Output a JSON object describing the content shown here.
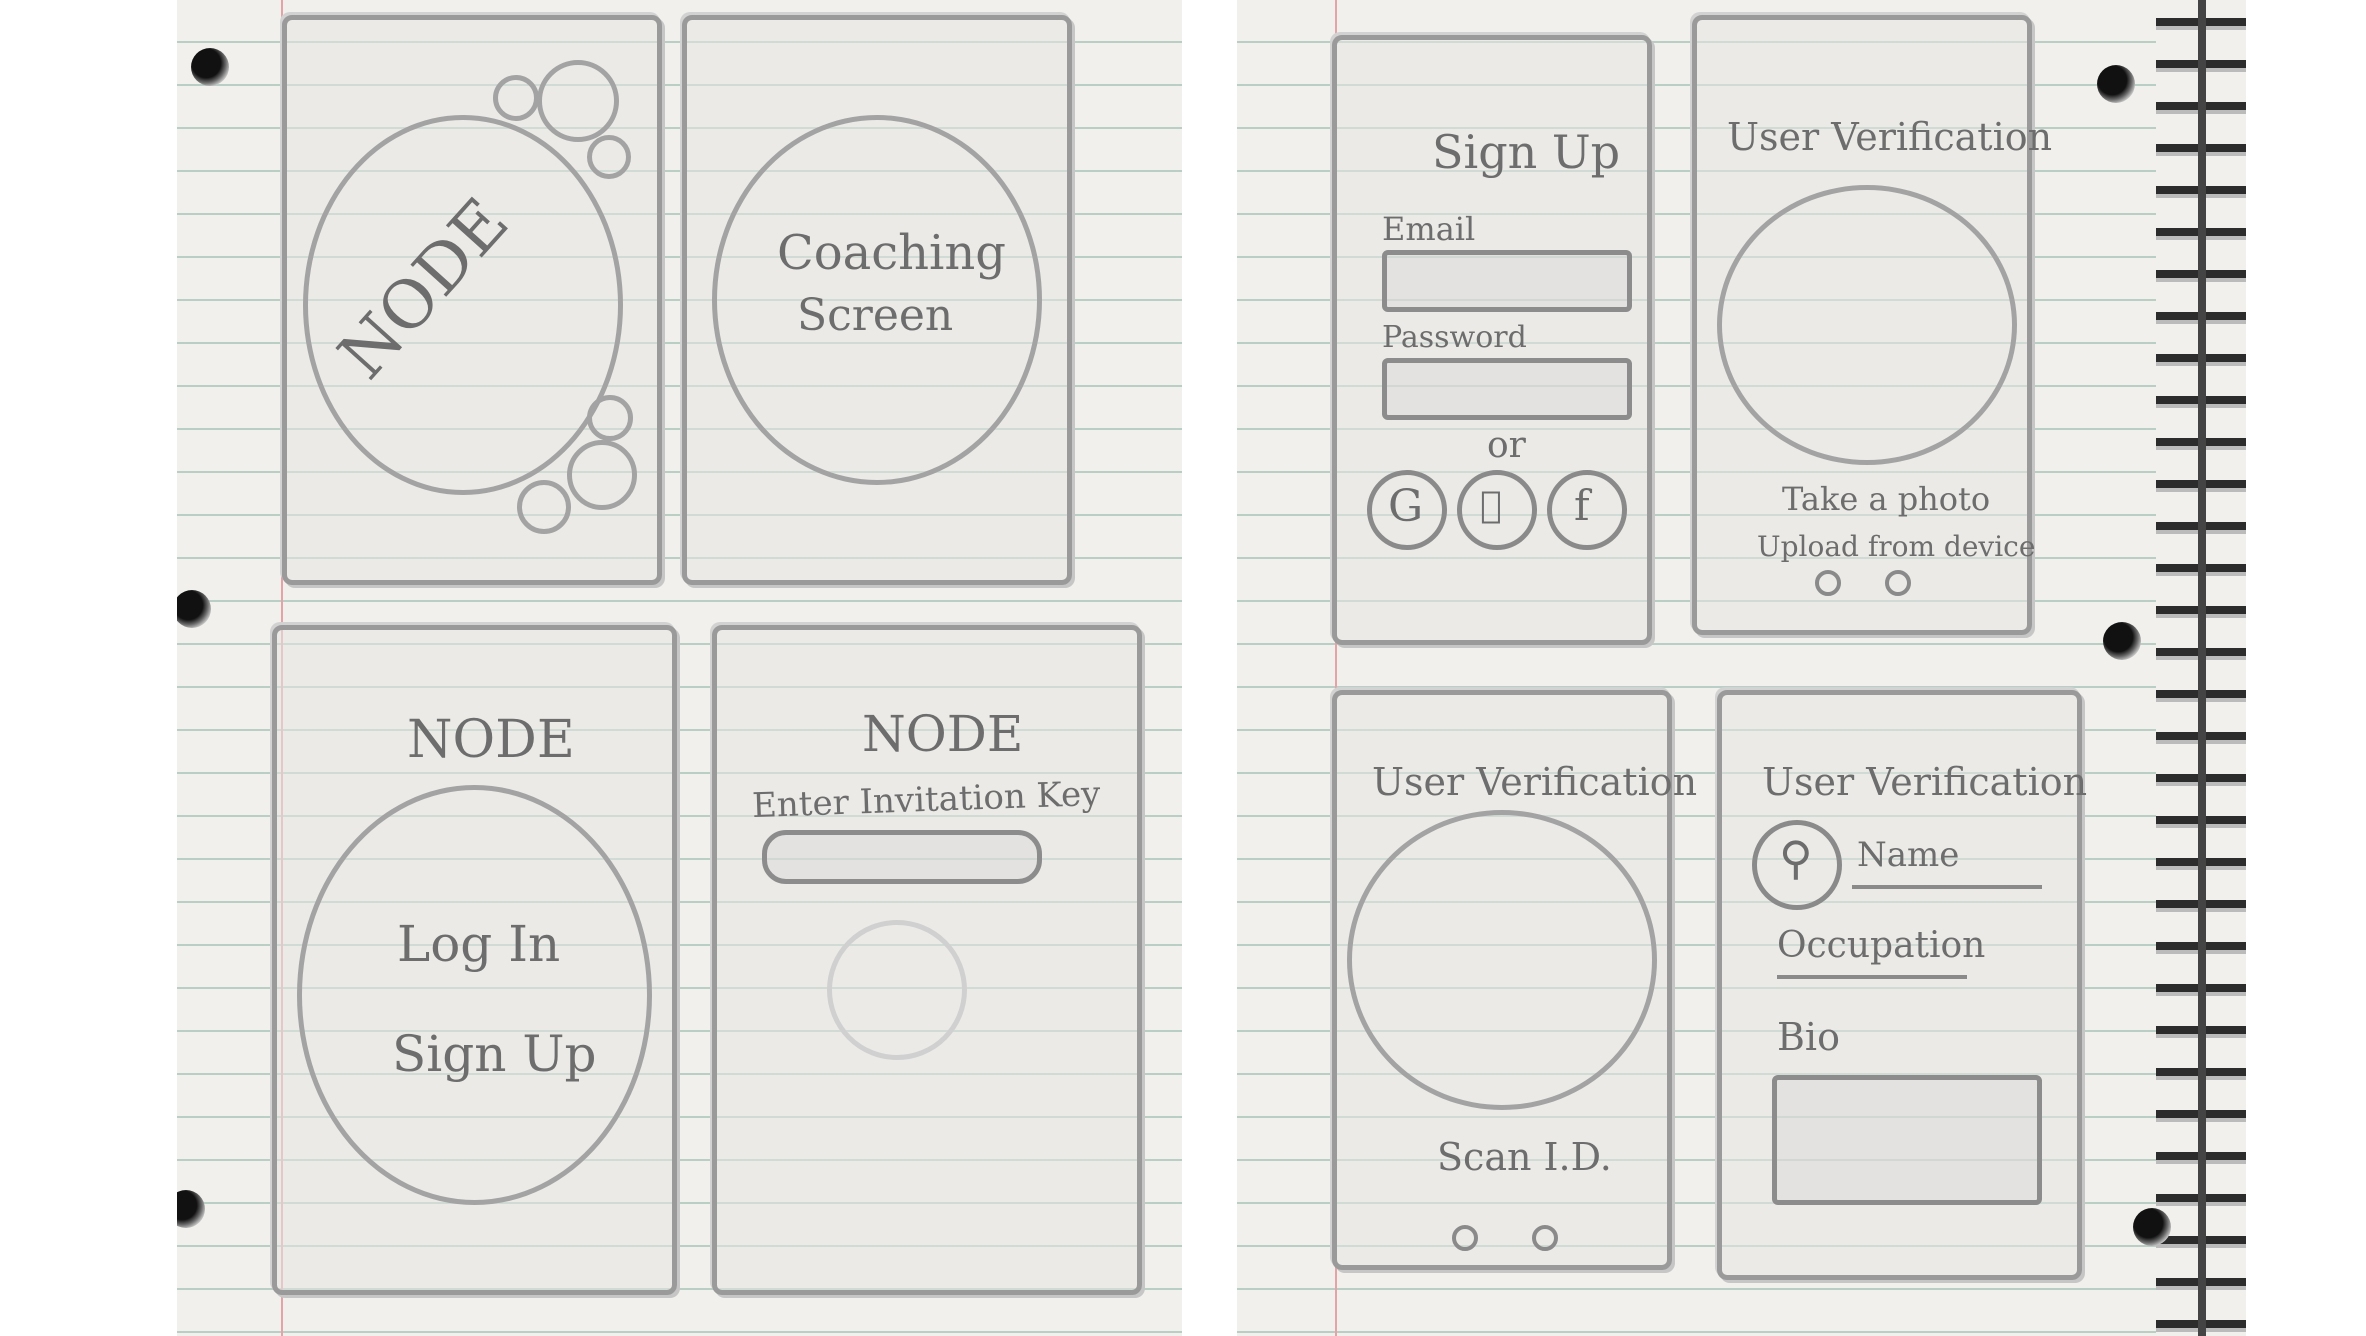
{
  "left_sheet": {
    "frame1": {
      "logo_text": "NODE"
    },
    "frame2": {
      "text_line1": "Coaching",
      "text_line2": "Screen"
    },
    "frame3": {
      "title": "NODE",
      "login_label": "Log In",
      "signup_label": "Sign Up"
    },
    "frame4": {
      "title": "NODE",
      "invite_label": "Enter Invitation Key"
    }
  },
  "right_sheet": {
    "frame1": {
      "title": "Sign Up",
      "email_label": "Email",
      "password_label": "Password",
      "or_label": "or",
      "social_buttons": [
        "G",
        "apple",
        "f"
      ]
    },
    "frame2": {
      "title": "User Verification",
      "take_photo": "Take a photo",
      "upload": "Upload from device"
    },
    "frame3": {
      "title": "User Verification",
      "scan_label": "Scan I.D."
    },
    "frame4": {
      "title": "User Verification",
      "name_label": "Name",
      "occupation_label": "Occupation",
      "bio_label": "Bio"
    }
  },
  "colors": {
    "paper": "#f1f0ec",
    "rule": "#b9cfc6",
    "margin": "#e4a3a6",
    "pencil": "#6d6d6d"
  }
}
